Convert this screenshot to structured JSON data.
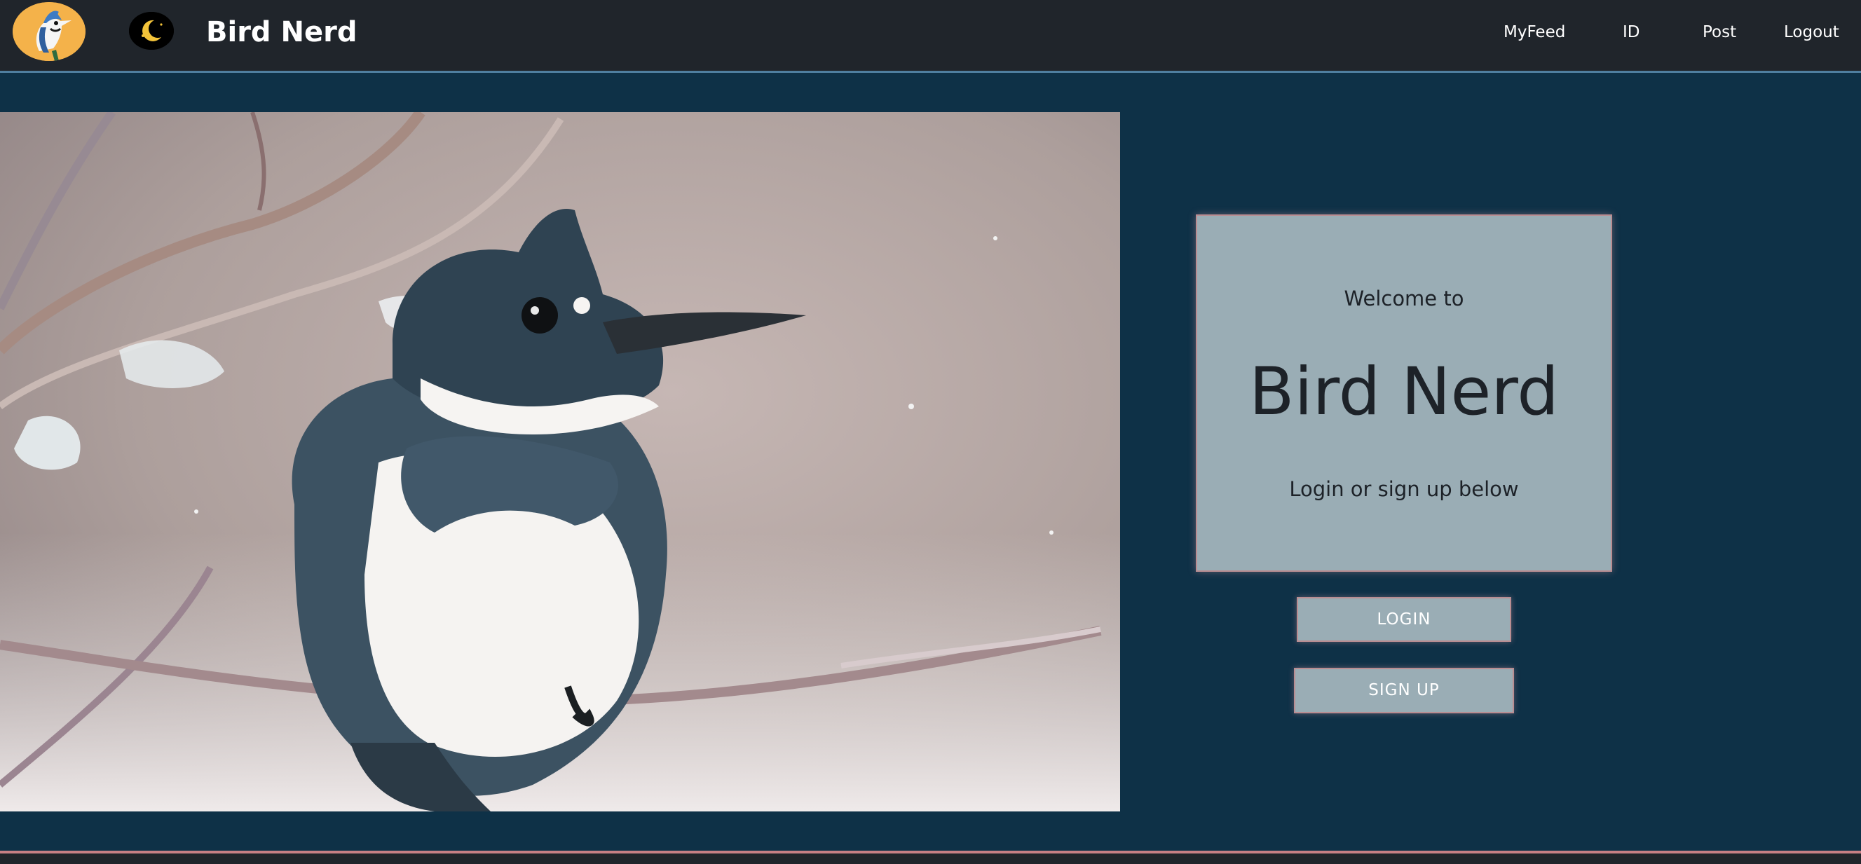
{
  "navbar": {
    "brand": "Bird Nerd",
    "links": [
      {
        "label": "MyFeed"
      },
      {
        "label": "ID"
      },
      {
        "label": "Post"
      },
      {
        "label": "Logout"
      }
    ]
  },
  "welcome": {
    "intro": "Welcome to",
    "title": "Bird Nerd",
    "subtitle": "Login or sign up below"
  },
  "buttons": {
    "login": "LOGIN",
    "signup": "SIGN UP"
  },
  "colors": {
    "navbar_bg": "#20252b",
    "page_bg": "#0e3147",
    "card_bg": "#9aadb5",
    "accent_border": "#b98d92",
    "footer_accent": "#c87f84"
  },
  "icons": {
    "logo": "blue-jay-logo-icon",
    "theme_toggle": "crescent-moon-icon"
  }
}
